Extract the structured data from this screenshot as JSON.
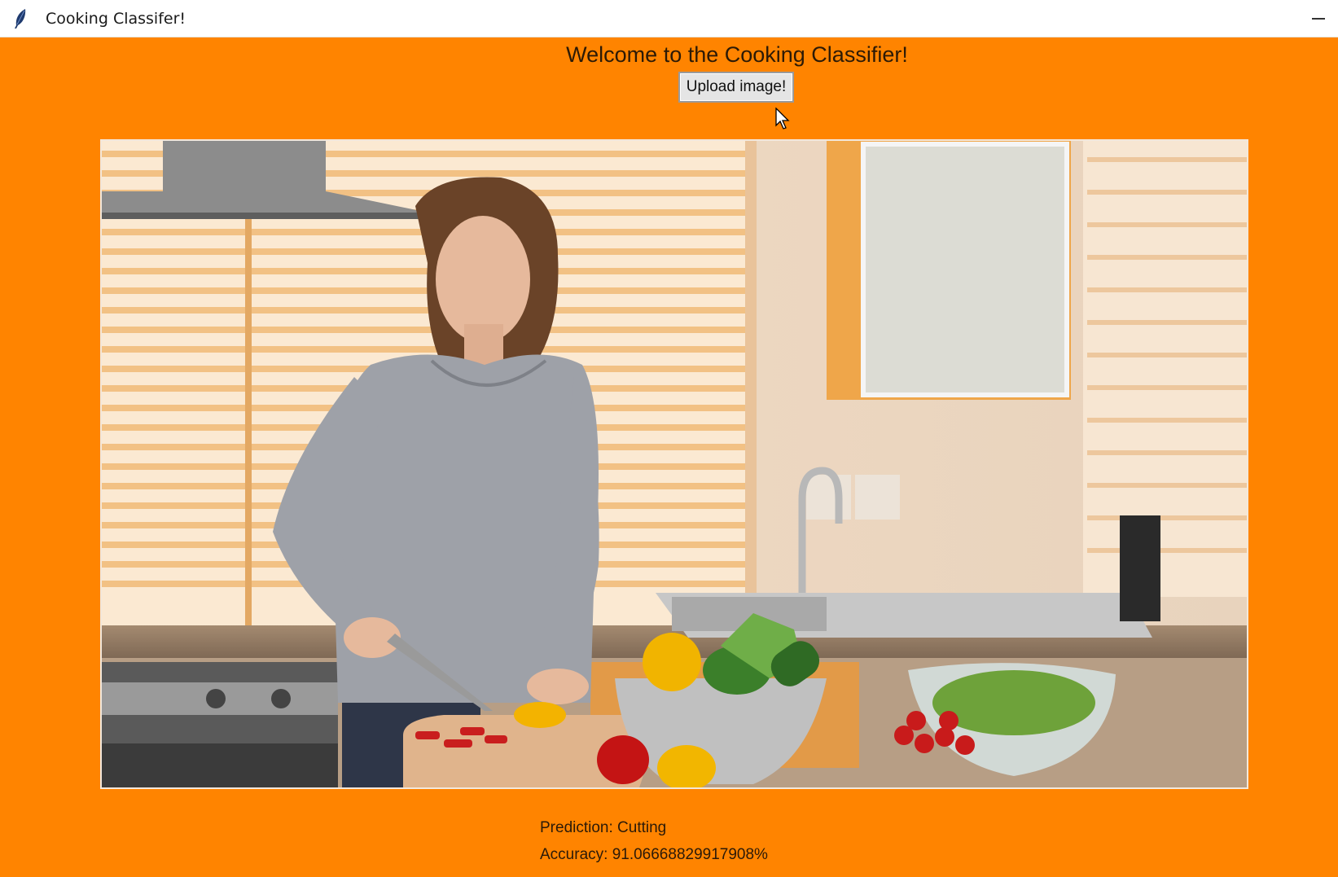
{
  "window": {
    "title": "Cooking Classifer!",
    "app_icon": "feather-icon",
    "minimize_icon": "minimize-icon"
  },
  "main": {
    "heading": "Welcome to the Cooking Classifier!",
    "upload_button_label": "Upload image!",
    "background_color": "#ff8400",
    "image_description_icon": "uploaded-photo",
    "prediction_text": "Prediction: Cutting",
    "accuracy_text": "Accuracy: 91.06668829917908%"
  }
}
